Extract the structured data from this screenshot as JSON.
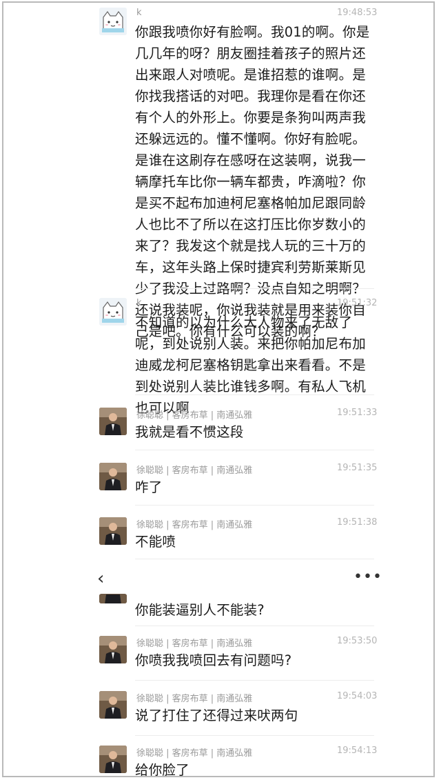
{
  "messages": [
    {
      "avatar": "cat",
      "name": "k",
      "time": "19:48:53",
      "text": "你跟我喷你好有脸啊。我01的啊。你是几几年的呀？朋友圈挂着孩子的照片还出来跟人对喷呢。是谁招惹的谁啊。是你找我搭话的对吧。我理你是看在你还有个人的外形上。你要是条狗叫两声我还躲远远的。懂不懂啊。你好有脸呢。是谁在这刷存在感呀在这装啊，说我一辆摩托车比你一辆车都贵，咋滴啦？你是买不起布加迪柯尼塞格帕加尼跟同龄人也比不了所以在这打压比你岁数小的来了？我发这个就是找人玩的三十万的车，这年头路上保时捷宾利劳斯莱斯见少了我没上过路啊？没点自知之明啊？还说我装呢，你说我装就是用来装你自己是吧。你有什么可以装的啊？"
    },
    {
      "avatar": "cat",
      "name": "k",
      "time": "19:51:32",
      "text": "不知道的以为什么大人物来了无敌了呢，到处说别人装。来把你帕加尼布加迪威龙柯尼塞格钥匙拿出来看看。不是到处说别人装比谁钱多啊。有私人飞机也可以啊"
    },
    {
      "avatar": "man",
      "name": "徐聪聪 | 客房布草 | 南通弘雅",
      "time": "19:51:33",
      "text": "我就是看不惯这段"
    },
    {
      "avatar": "man",
      "name": "徐聪聪 | 客房布草 | 南通弘雅",
      "time": "19:51:35",
      "text": "咋了"
    },
    {
      "avatar": "man",
      "name": "徐聪聪 | 客房布草 | 南通弘雅",
      "time": "19:51:38",
      "text": "不能喷"
    },
    {
      "avatar": "man",
      "name": "",
      "time": "",
      "text": "你能装逼别人不能装?"
    },
    {
      "avatar": "man",
      "name": "徐聪聪 | 客房布草 | 南通弘雅",
      "time": "19:53:50",
      "text": "你喷我我喷回去有问题吗?"
    },
    {
      "avatar": "man",
      "name": "徐聪聪 | 客房布草 | 南通弘雅",
      "time": "19:54:03",
      "text": "说了打住了还得过来吠两句"
    },
    {
      "avatar": "man",
      "name": "徐聪聪 | 客房布草 | 南通弘雅",
      "time": "19:54:13",
      "text": "给你脸了"
    }
  ],
  "nav": {
    "back_icon": "chevron-left-icon",
    "more_icon": "more-dots-icon",
    "back_glyph": "‹",
    "more_glyph": "•••"
  },
  "colors": {
    "text": "#1b1b1b",
    "meta": "#9a9a9a",
    "time": "#b5b5b5",
    "border": "#b9b9b9"
  }
}
